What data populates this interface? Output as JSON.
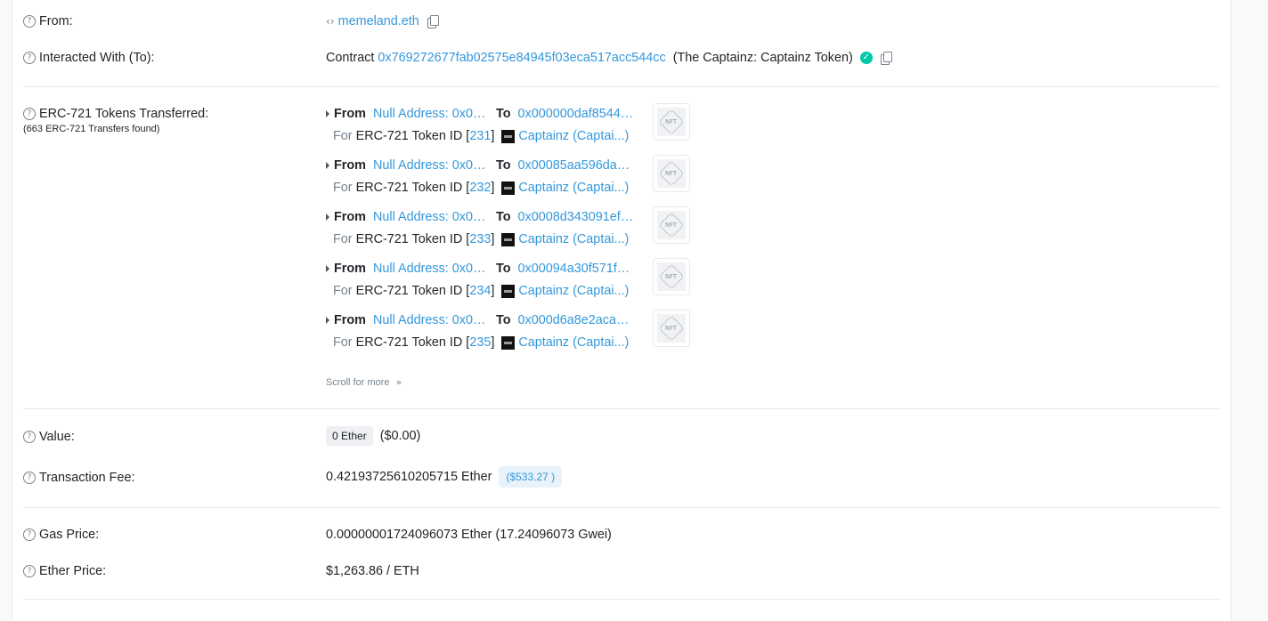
{
  "from": {
    "label": "From:",
    "value": "memeland.eth"
  },
  "interacted": {
    "label": "Interacted With (To):",
    "prefix": "Contract",
    "address": "0x769272677fab02575e84945f03eca517acc544cc",
    "name": "(The Captainz: Captainz Token)"
  },
  "erc721": {
    "label": "ERC-721 Tokens Transferred:",
    "sub": "(663 ERC-721 Transfers found)",
    "from_word": "From",
    "to_word": "To",
    "for_word": "For",
    "token_id_text": "ERC-721 Token ID [",
    "close_bracket": "]",
    "nft_icon_text": "NFT",
    "transfers": [
      {
        "from": "Null Address: 0x00…",
        "to": "0x000000daf8544…",
        "token_id": "231",
        "token_name": "Captainz (Captai...)"
      },
      {
        "from": "Null Address: 0x00…",
        "to": "0x00085aa596da2…",
        "token_id": "232",
        "token_name": "Captainz (Captai...)"
      },
      {
        "from": "Null Address: 0x00…",
        "to": "0x0008d343091ef…",
        "token_id": "233",
        "token_name": "Captainz (Captai...)"
      },
      {
        "from": "Null Address: 0x00…",
        "to": "0x00094a30f571f4…",
        "token_id": "234",
        "token_name": "Captainz (Captai...)"
      },
      {
        "from": "Null Address: 0x00…",
        "to": "0x000d6a8e2aca5…",
        "token_id": "235",
        "token_name": "Captainz (Captai...)"
      }
    ],
    "scroll_more": "Scroll for more"
  },
  "value": {
    "label": "Value:",
    "amount": "0 Ether",
    "usd": "($0.00)"
  },
  "fee": {
    "label": "Transaction Fee:",
    "amount": "0.42193725610205715 Ether",
    "usd": "($533.27 )"
  },
  "gas": {
    "label": "Gas Price:",
    "value": "0.00000001724096073 Ether (17.24096073 Gwei)"
  },
  "ether_price": {
    "label": "Ether Price:",
    "value": "$1,263.86 / ETH"
  }
}
